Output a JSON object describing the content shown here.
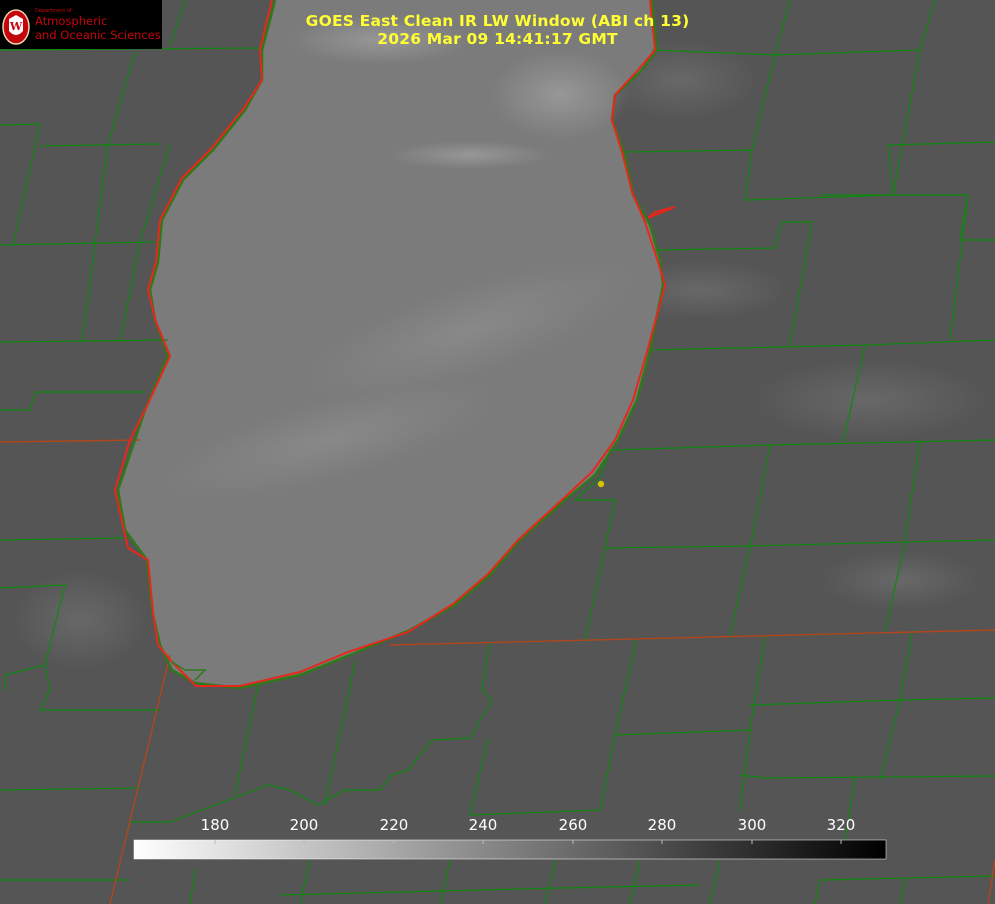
{
  "logo": {
    "department": "Department of",
    "line1": "Atmospheric",
    "line2": "and Oceanic Sciences",
    "seal_letter": "W",
    "color": "#c5050c"
  },
  "title": {
    "line1": "GOES East Clean IR LW Window (ABI ch 13)",
    "line2": "2026 Mar 09 14:41:17 GMT",
    "color": "#ffff33"
  },
  "map_colors": {
    "land": "#565656",
    "lake": "#7a7a7a",
    "county_lines": "#0f8a0f",
    "state_lines": "#a04010",
    "coastline": "#e8261c",
    "station_marker": "#d4c400"
  },
  "colorbar": {
    "ticks": [
      "180",
      "200",
      "220",
      "240",
      "260",
      "280",
      "300",
      "320"
    ],
    "gradient": [
      "#ffffff",
      "#000000"
    ]
  }
}
